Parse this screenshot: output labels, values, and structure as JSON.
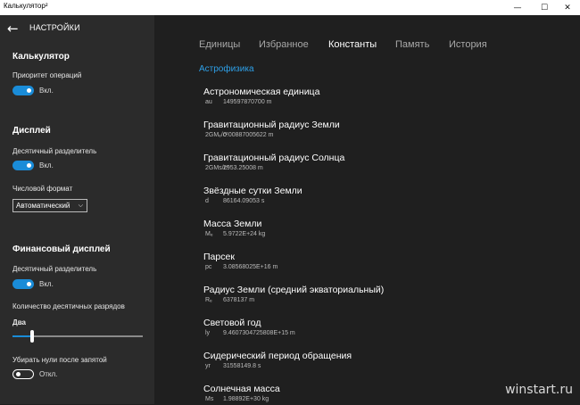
{
  "window": {
    "title": "Калькулятор²",
    "minimize_icon": "—",
    "maximize_icon": "☐",
    "close_icon": "✕"
  },
  "nav": {
    "back_icon": "←",
    "title": "НАСТРОЙКИ"
  },
  "calculator": {
    "heading": "Калькулятор",
    "priority_label": "Приоритет операций",
    "priority_state": "Вкл."
  },
  "display": {
    "heading": "Дисплей",
    "decimal_label": "Десятичный разделитель",
    "decimal_state": "Вкл.",
    "format_label": "Числовой формат",
    "format_value": "Автоматический",
    "format_chevron": "⌵"
  },
  "finance": {
    "heading": "Финансовый дисплей",
    "decimal_label": "Десятичный разделитель",
    "decimal_state": "Вкл.",
    "places_label": "Количество десятичных разрядов",
    "places_value": "Два",
    "slider_fraction": 0.15,
    "zeros_label": "Убирать нули после запятой",
    "zeros_state": "Откл."
  },
  "tabs": [
    "Единицы",
    "Избранное",
    "Константы",
    "Память",
    "История"
  ],
  "section_title": "Астрофизика",
  "constants": [
    {
      "name": "Астрономическая единица",
      "symbol": "au",
      "value": "149597870700 m"
    },
    {
      "name": "Гравитационный радиус Земли",
      "symbol": "2GMₑ/c²",
      "value": "0.00887005622 m"
    },
    {
      "name": "Гравитационный радиус Солнца",
      "symbol": "2GMs/c²",
      "value": "2953.25008 m"
    },
    {
      "name": "Звёздные сутки Земли",
      "symbol": "d",
      "value": "86164.09053 s"
    },
    {
      "name": "Масса Земли",
      "symbol": "Mₑ",
      "value": "5.9722E+24 kg"
    },
    {
      "name": "Парсек",
      "symbol": "pc",
      "value": "3.08568025E+16 m"
    },
    {
      "name": "Радиус Земли (средний экваториальный)",
      "symbol": "Rₑ",
      "value": "6378137 m"
    },
    {
      "name": "Световой год",
      "symbol": "ly",
      "value": "9.4607304725808E+15 m"
    },
    {
      "name": "Сидерический период обращения",
      "symbol": "yr",
      "value": "31558149.8 s"
    },
    {
      "name": "Солнечная масса",
      "symbol": "Ms",
      "value": "1.98892E+30 kg"
    }
  ],
  "watermark": "winstart.ru"
}
